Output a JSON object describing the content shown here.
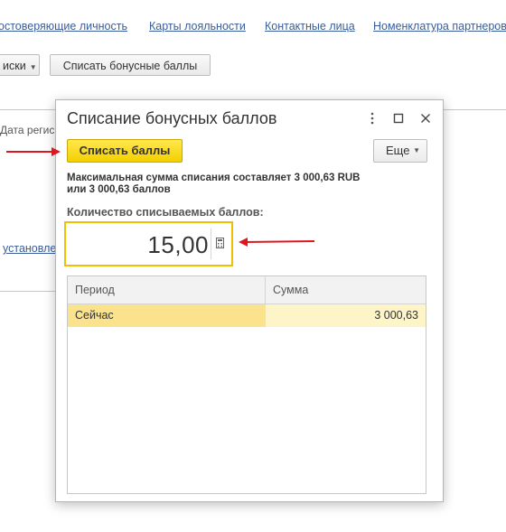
{
  "background": {
    "links": [
      "остоверяющие личность",
      "Карты лояльности",
      "Контактные лица",
      "Номенклатура партнеров"
    ],
    "buttons": {
      "dropdown_label": "иски",
      "writeoff_label": "Списать бонусные баллы"
    },
    "date_label": "Дата регис",
    "link_label": "установле"
  },
  "dialog": {
    "title": "Списание бонусных баллов",
    "primary_button": "Списать баллы",
    "more_button": "Еще",
    "info_line1": "Максимальная сумма списания составляет 3 000,63 RUB",
    "info_line2": "или 3 000,63 баллов",
    "field_label": "Количество списываемых баллов:",
    "field_value": "15,00",
    "table": {
      "headers": [
        "Период",
        "Сумма"
      ],
      "rows": [
        {
          "period": "Сейчас",
          "amount": "3 000,63"
        }
      ]
    }
  },
  "colors": {
    "accent_yellow": "#f4cf00",
    "link_blue": "#3a5d99",
    "arrow_red": "#e0161c",
    "row_highlight": "#fae38c"
  }
}
